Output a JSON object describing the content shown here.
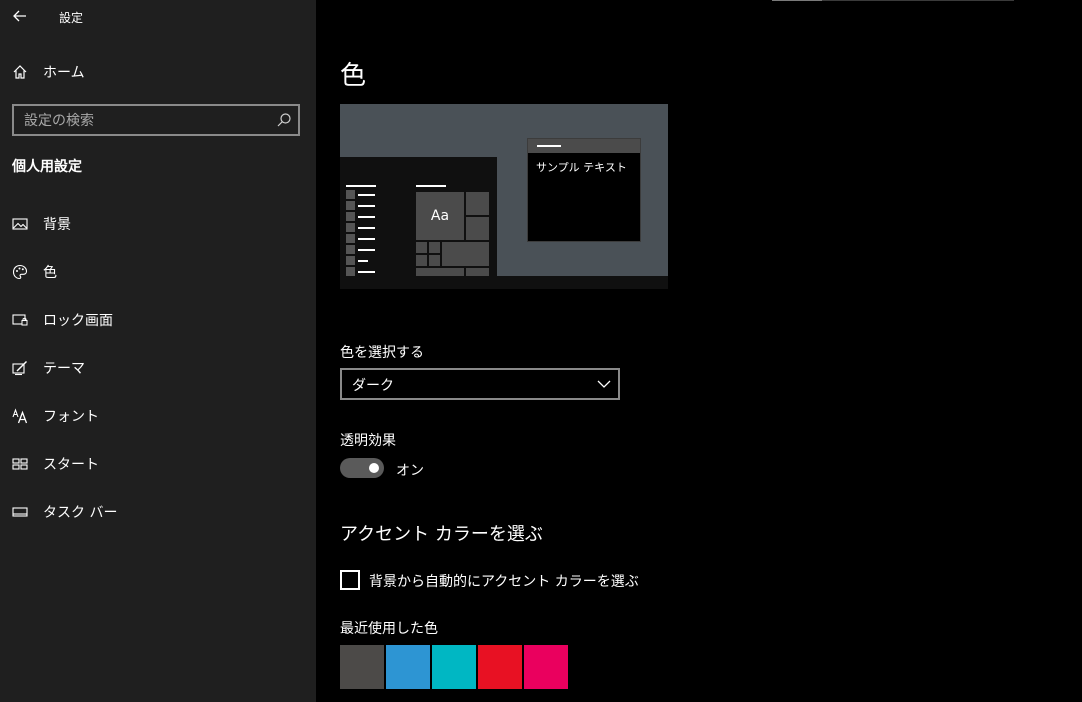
{
  "window": {
    "title": "設定"
  },
  "sidebar": {
    "home_label": "ホーム",
    "search_placeholder": "設定の検索",
    "section_heading": "個人用設定",
    "items": [
      {
        "label": "背景",
        "icon": "picture-icon"
      },
      {
        "label": "色",
        "icon": "palette-icon"
      },
      {
        "label": "ロック画面",
        "icon": "lock-screen-icon"
      },
      {
        "label": "テーマ",
        "icon": "theme-icon"
      },
      {
        "label": "フォント",
        "icon": "font-icon"
      },
      {
        "label": "スタート",
        "icon": "start-icon"
      },
      {
        "label": "タスク バー",
        "icon": "taskbar-icon"
      }
    ]
  },
  "main": {
    "title": "色",
    "preview": {
      "sample_text": "サンプル テキスト",
      "tile_text": "Aa"
    },
    "choose_color": {
      "label": "色を選択する",
      "value": "ダーク"
    },
    "transparency": {
      "label": "透明効果",
      "state": "オン"
    },
    "accent": {
      "heading": "アクセント カラーを選ぶ",
      "auto_label": "背景から自動的にアクセント カラーを選ぶ",
      "recent_label": "最近使用した色",
      "recent_colors": [
        "#4c4a48",
        "#2d95d3",
        "#00b7c3",
        "#e81123",
        "#ea005e"
      ]
    }
  },
  "colors": {
    "sidebar_bg": "#1f1f1f",
    "main_bg": "#000000",
    "preview_bg": "#4a5157"
  }
}
